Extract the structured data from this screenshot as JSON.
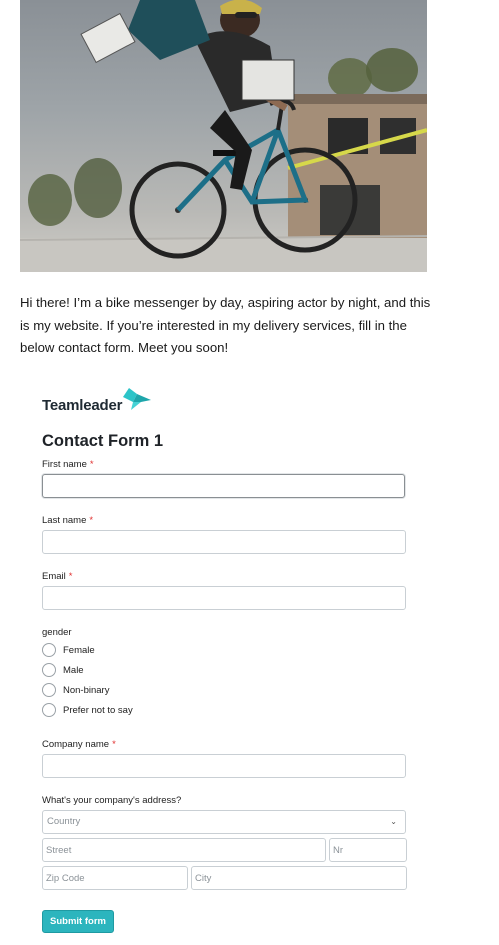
{
  "hero": {
    "image_alt": "bike-messenger-photo"
  },
  "intro": {
    "text": "Hi there! I’m a bike messenger by day, aspiring actor by night, and this is my website. If you’re interested in my delivery services, fill in the below contact form. Meet you soon!"
  },
  "form": {
    "brand": "Teamleader",
    "title": "Contact Form 1",
    "required_mark": "*",
    "fields": {
      "first_name": {
        "label": "First name",
        "value": ""
      },
      "last_name": {
        "label": "Last name",
        "value": ""
      },
      "email": {
        "label": "Email",
        "value": ""
      },
      "company_name": {
        "label": "Company name",
        "value": ""
      }
    },
    "gender": {
      "label": "gender",
      "options": [
        "Female",
        "Male",
        "Non-binary",
        "Prefer not to say"
      ]
    },
    "address": {
      "label": "What's your company's address?",
      "country_placeholder": "Country",
      "street_placeholder": "Street",
      "number_placeholder": "Nr",
      "zip_placeholder": "Zip Code",
      "city_placeholder": "City"
    },
    "submit_label": "Submit form"
  },
  "colors": {
    "accent": "#2cb5be",
    "required": "#e0302f",
    "logo_mark": "#2cc4c8"
  }
}
